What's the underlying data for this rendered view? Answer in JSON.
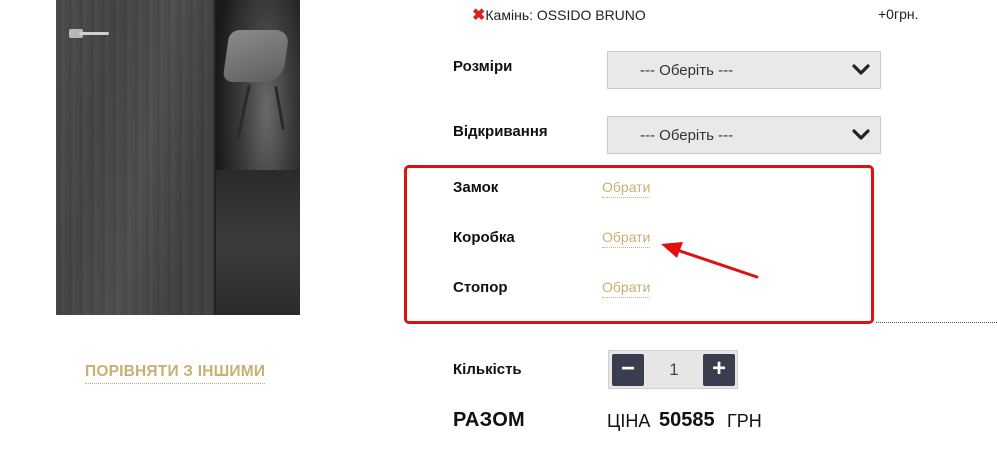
{
  "product": {
    "compare_label": "ПОРІВНЯТИ З ІНШИМИ"
  },
  "stone_option": {
    "icon": "remove-x-icon",
    "text": "Камінь: OSSIDO BRUNO",
    "price": "+0грн."
  },
  "options": {
    "sizes": {
      "label": "Розміри",
      "selected": "--- Оберіть ---"
    },
    "opening": {
      "label": "Відкривання",
      "selected": "--- Оберіть ---"
    }
  },
  "accessories": [
    {
      "label": "Замок",
      "action": "Обрати"
    },
    {
      "label": "Коробка",
      "action": "Обрати"
    },
    {
      "label": "Стопор",
      "action": "Обрати"
    }
  ],
  "quantity": {
    "label": "Кількість",
    "value": "1",
    "minus": "−",
    "plus": "+"
  },
  "total": {
    "label": "РАЗОМ",
    "price_word": "ЦІНА",
    "price_value": "50585",
    "currency": "ГРН"
  },
  "colors": {
    "accent_gold": "#c8b071",
    "highlight_red": "#e01010",
    "button_dark": "#3a3d4d"
  }
}
